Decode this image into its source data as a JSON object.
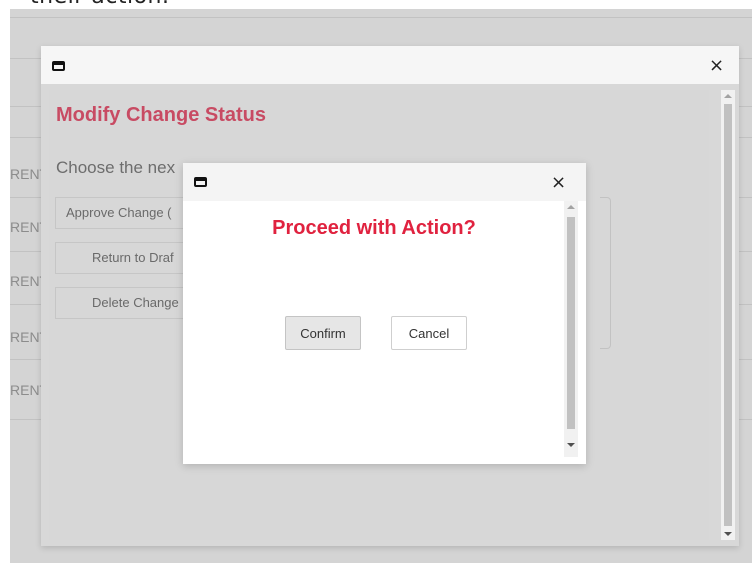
{
  "page": {
    "top_caption": "their action."
  },
  "background": {
    "row_label": "RENT"
  },
  "outer_dialog": {
    "heading": "Modify Change Status",
    "subtitle_visible": "Choose the nex",
    "options": [
      {
        "label": "Approve Change ("
      },
      {
        "label": "Return to Draf"
      },
      {
        "label": "Delete Change"
      }
    ]
  },
  "inner_dialog": {
    "heading": "Proceed with Action?",
    "confirm_label": "Confirm",
    "cancel_label": "Cancel"
  },
  "icons": {
    "window_icon": "window-icon",
    "close_icon": "close-icon",
    "close_glyph": "×"
  },
  "colors": {
    "outer_heading": "#c84b63",
    "inner_heading": "#e0223f"
  }
}
